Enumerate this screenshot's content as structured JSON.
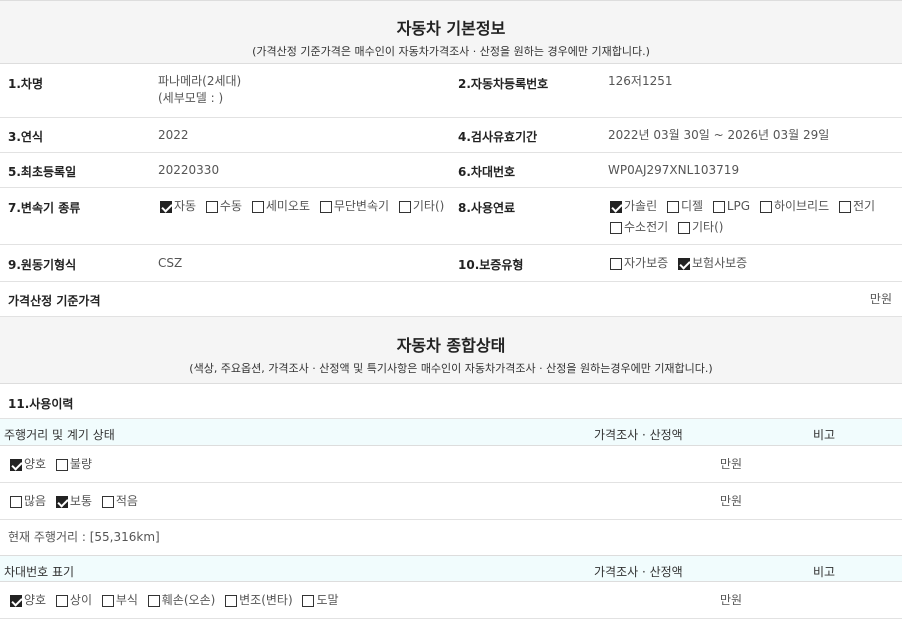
{
  "basic": {
    "title": "자동차 기본정보",
    "subtitle": "(가격산정 기준가격은 매수인이 자동차가격조사 · 산정을 원하는 경우에만 기재합니다.)",
    "car_name_label": "1.차명",
    "car_name": "파나메라(2세대)",
    "car_model": "(세부모델 : )",
    "reg_no_label": "2.자동차등록번호",
    "reg_no": "126저1251",
    "year_label": "3.연식",
    "year": "2022",
    "inspection_label": "4.검사유효기간",
    "inspection": "2022년 03월 30일 ~ 2026년 03월 29일",
    "first_reg_label": "5.최초등록일",
    "first_reg": "20220330",
    "vin_label": "6.차대번호",
    "vin": "WP0AJ297XNL103719",
    "trans_label": "7.변속기 종류",
    "trans_options": [
      {
        "label": "자동",
        "checked": true
      },
      {
        "label": "수동",
        "checked": false
      },
      {
        "label": "세미오토",
        "checked": false
      },
      {
        "label": "무단변속기",
        "checked": false
      },
      {
        "label": "기타()",
        "checked": false
      }
    ],
    "fuel_label": "8.사용연료",
    "fuel_options": [
      {
        "label": "가솔린",
        "checked": true
      },
      {
        "label": "디젤",
        "checked": false
      },
      {
        "label": "LPG",
        "checked": false
      },
      {
        "label": "하이브리드",
        "checked": false
      },
      {
        "label": "전기",
        "checked": false
      },
      {
        "label": "수소전기",
        "checked": false
      },
      {
        "label": "기타()",
        "checked": false
      }
    ],
    "engine_label": "9.원동기형식",
    "engine": "CSZ",
    "warranty_label": "10.보증유형",
    "warranty_options": [
      {
        "label": "자가보증",
        "checked": false
      },
      {
        "label": "보험사보증",
        "checked": true
      }
    ],
    "price_label": "가격산정 기준가격",
    "price_unit": "만원"
  },
  "status": {
    "title": "자동차 종합상태",
    "subtitle": "(색상, 주요옵션, 가격조사 · 산정액 및 특기사항은 매수인이 자동차가격조사 · 산정을 원하는경우에만 기재합니다.)",
    "history_label": "11.사용이력",
    "mileage_head": "주행거리 및 계기 상태",
    "price_head": "가격조사 · 산정액",
    "note_head": "비고",
    "gauge_options": [
      {
        "label": "양호",
        "checked": true
      },
      {
        "label": "불량",
        "checked": false
      }
    ],
    "gauge_unit": "만원",
    "mileage_options": [
      {
        "label": "많음",
        "checked": false
      },
      {
        "label": "보통",
        "checked": true
      },
      {
        "label": "적음",
        "checked": false
      }
    ],
    "mileage_unit": "만원",
    "current_mileage": "현재 주행거리 : [55,316km]",
    "vin_head": "차대번호 표기",
    "vin_price_head": "가격조사 · 산정액",
    "vin_note_head": "비고",
    "vin_options": [
      {
        "label": "양호",
        "checked": true
      },
      {
        "label": "상이",
        "checked": false
      },
      {
        "label": "부식",
        "checked": false
      },
      {
        "label": "훼손(오손)",
        "checked": false
      },
      {
        "label": "변조(변타)",
        "checked": false
      },
      {
        "label": "도말",
        "checked": false
      }
    ],
    "vin_unit": "만원"
  }
}
